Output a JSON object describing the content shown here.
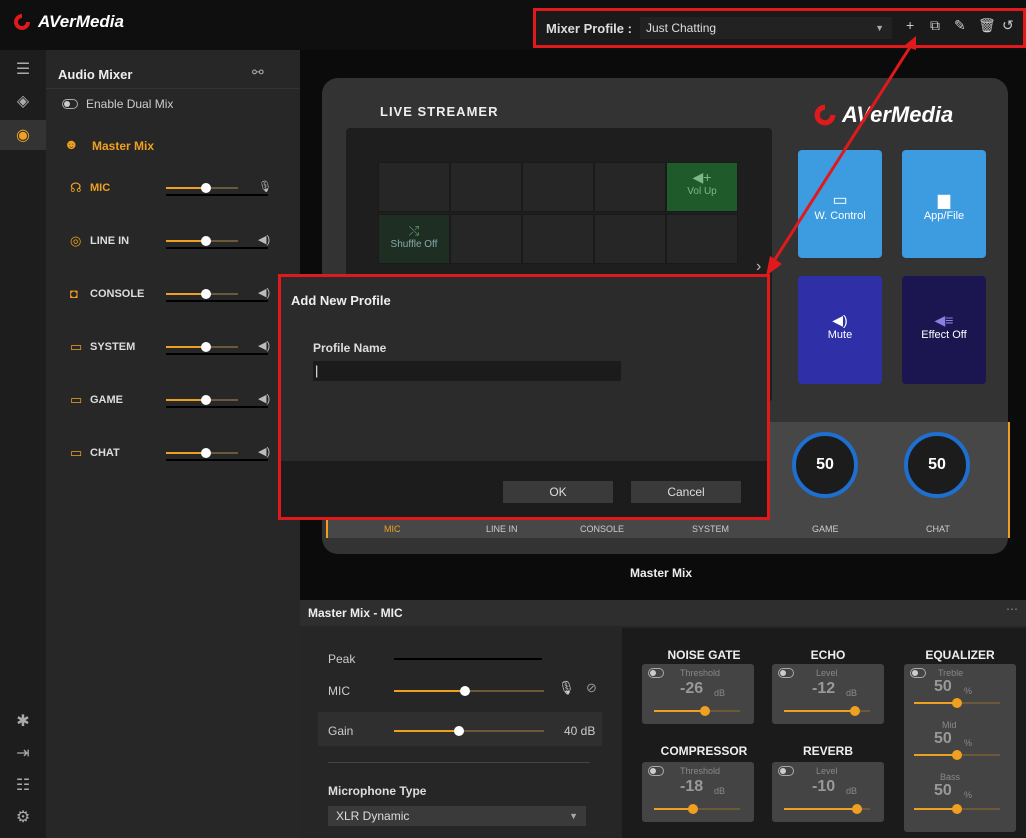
{
  "app": {
    "brand": "AVerMedia"
  },
  "mixer_profile": {
    "label": "Mixer Profile :",
    "selected": "Just Chatting"
  },
  "sidebar": {
    "title": "Audio Mixer",
    "dual_mix": "Enable Dual Mix",
    "master_mix": "Master Mix",
    "channels": [
      {
        "label": "MIC",
        "icon": "mic-icon",
        "level": 0.55
      },
      {
        "label": "LINE IN",
        "icon": "line-in-icon",
        "level": 0.55
      },
      {
        "label": "CONSOLE",
        "icon": "console-icon",
        "level": 0.55
      },
      {
        "label": "SYSTEM",
        "icon": "system-icon",
        "level": 0.55
      },
      {
        "label": "GAME",
        "icon": "game-icon",
        "level": 0.55
      },
      {
        "label": "CHAT",
        "icon": "chat-icon",
        "level": 0.55
      }
    ]
  },
  "device": {
    "title": "LIVE STREAMER",
    "brand": "AVerMedia",
    "keys": [
      {
        "label": "Vol Up"
      },
      {
        "label": "Shuffle Off"
      }
    ],
    "big_keys": [
      {
        "label": "W. Control",
        "color": "#3d9be0"
      },
      {
        "label": "App/File",
        "color": "#3d9be0"
      },
      {
        "label": "Mute",
        "color": "#2f2fa8"
      },
      {
        "label": "Effect Off",
        "color": "#1c1650"
      }
    ],
    "knobs": [
      {
        "value": "50"
      },
      {
        "value": "50"
      }
    ],
    "channel_labels": [
      "MIC",
      "LINE IN",
      "CONSOLE",
      "SYSTEM",
      "GAME",
      "CHAT"
    ],
    "footer": "Master Mix"
  },
  "dialog": {
    "title": "Add New Profile",
    "field_label": "Profile Name",
    "field_value": "|",
    "ok": "OK",
    "cancel": "Cancel"
  },
  "bottom": {
    "title": "Master Mix - MIC",
    "peak": "Peak",
    "mic": "MIC",
    "gain": "Gain",
    "gain_value": "40 dB",
    "mic_type_label": "Microphone Type",
    "mic_type_value": "XLR Dynamic",
    "noise_gate": {
      "title": "NOISE GATE",
      "sub": "Threshold",
      "value": "-26",
      "unit": "dB"
    },
    "echo": {
      "title": "ECHO",
      "sub": "Level",
      "value": "-12",
      "unit": "dB"
    },
    "equalizer": {
      "title": "EQUALIZER",
      "treble": "Treble",
      "treble_val": "50",
      "mid": "Mid",
      "mid_val": "50",
      "bass": "Bass",
      "bass_val": "50",
      "unit": "%"
    },
    "compressor": {
      "title": "COMPRESSOR",
      "sub": "Threshold",
      "value": "-18",
      "unit": "dB"
    },
    "reverb": {
      "title": "REVERB",
      "sub": "Level",
      "value": "-10",
      "unit": "dB"
    }
  }
}
